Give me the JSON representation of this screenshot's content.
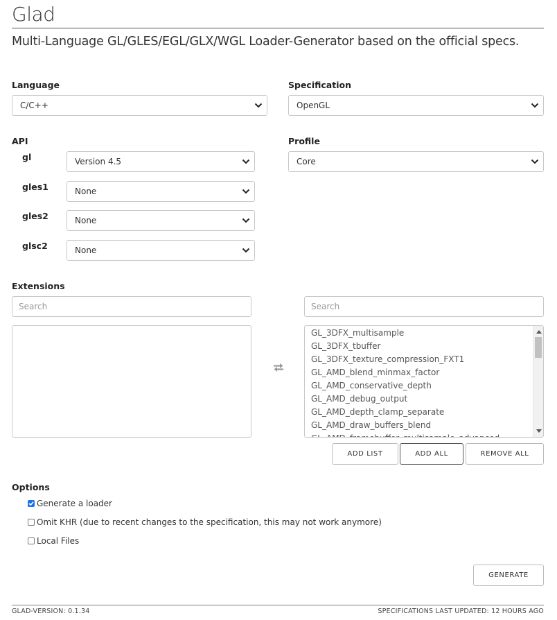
{
  "header": {
    "title": "Glad",
    "subtitle": "Multi-Language GL/GLES/EGL/GLX/WGL Loader-Generator based on the official specs."
  },
  "language": {
    "label": "Language",
    "value": "C/C++"
  },
  "specification": {
    "label": "Specification",
    "value": "OpenGL"
  },
  "api": {
    "label": "API",
    "rows": [
      {
        "name": "gl",
        "value": "Version 4.5"
      },
      {
        "name": "gles1",
        "value": "None"
      },
      {
        "name": "gles2",
        "value": "None"
      },
      {
        "name": "glsc2",
        "value": "None"
      }
    ]
  },
  "profile": {
    "label": "Profile",
    "value": "Core"
  },
  "extensions": {
    "label": "Extensions",
    "left_search_placeholder": "Search",
    "right_search_placeholder": "Search",
    "selected": [],
    "available": [
      "GL_3DFX_multisample",
      "GL_3DFX_tbuffer",
      "GL_3DFX_texture_compression_FXT1",
      "GL_AMD_blend_minmax_factor",
      "GL_AMD_conservative_depth",
      "GL_AMD_debug_output",
      "GL_AMD_depth_clamp_separate",
      "GL_AMD_draw_buffers_blend",
      "GL_AMD_framebuffer_multisample_advanced"
    ],
    "buttons": {
      "add_list": "ADD LIST",
      "add_all": "ADD ALL",
      "remove_all": "REMOVE ALL"
    },
    "transfer_icon": "swap-arrows-icon"
  },
  "options": {
    "label": "Options",
    "items": [
      {
        "label": "Generate a loader",
        "checked": true
      },
      {
        "label": "Omit KHR (due to recent changes to the specification, this may not work anymore)",
        "checked": false
      },
      {
        "label": "Local Files",
        "checked": false
      }
    ]
  },
  "generate_label": "GENERATE",
  "footer": {
    "version": "GLAD-VERSION: 0.1.34",
    "updated": "SPECIFICATIONS LAST UPDATED: 12 HOURS AGO"
  },
  "colors": {
    "accent": "#1a73e8",
    "border": "#c8c8c8"
  }
}
